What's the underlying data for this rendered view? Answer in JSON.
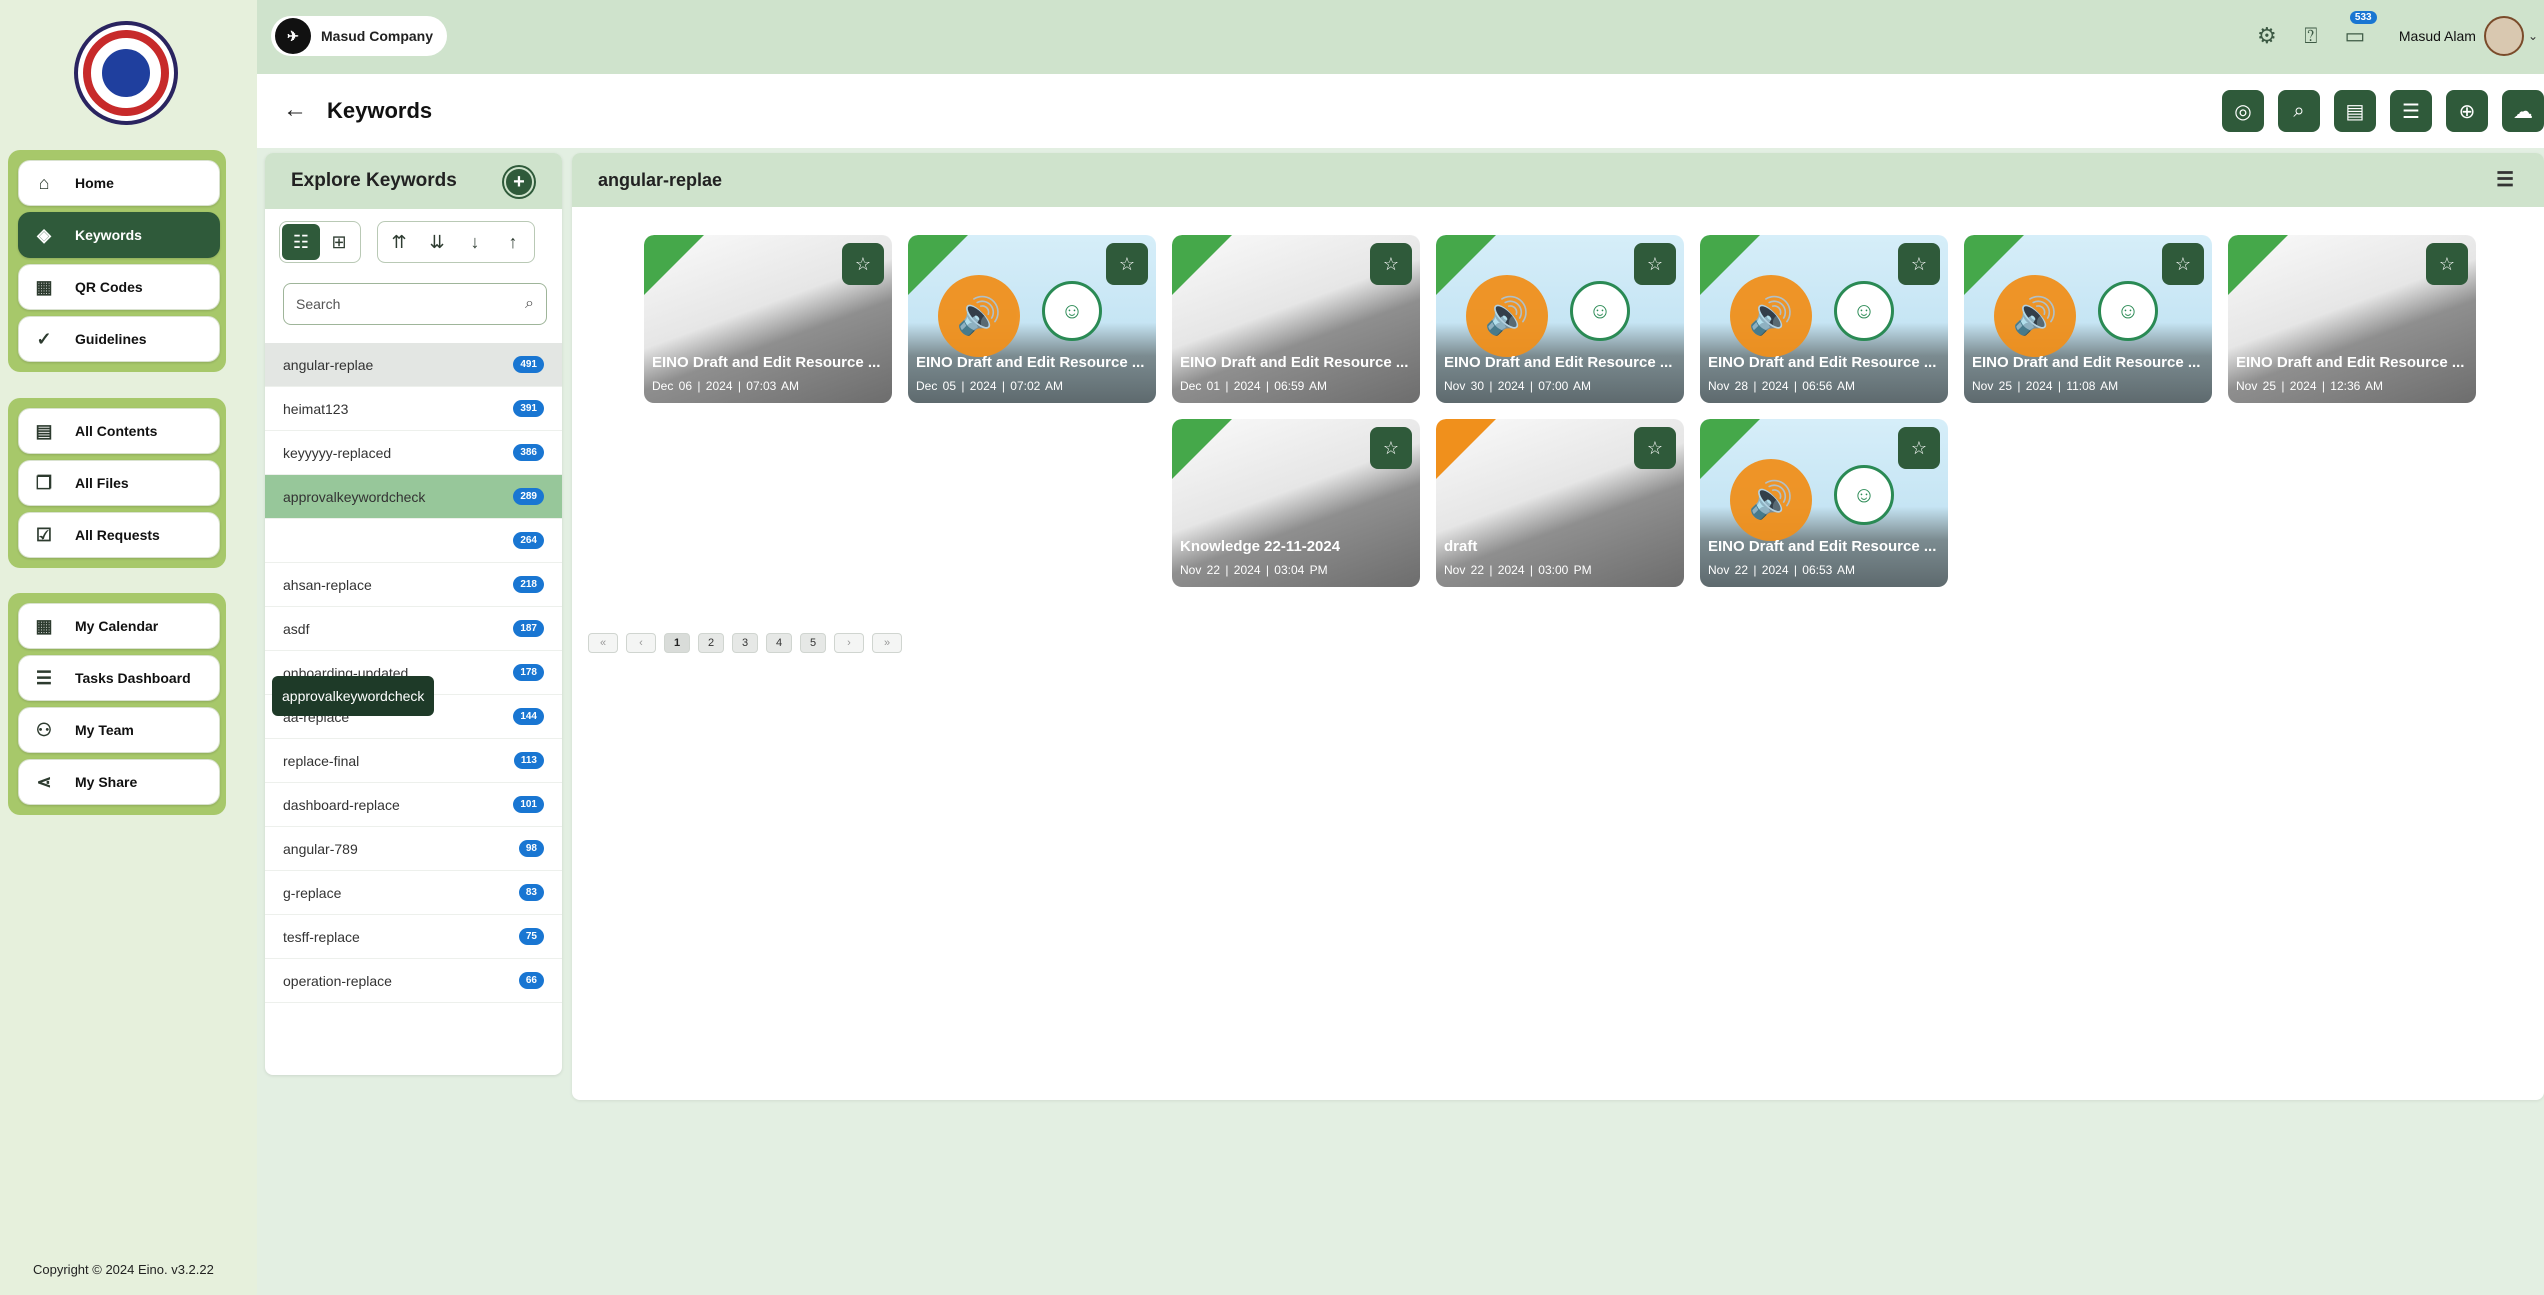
{
  "sidebar": {
    "groups": [
      [
        {
          "label": "Home",
          "icon": "home-icon",
          "glyph": "⌂"
        },
        {
          "label": "Keywords",
          "icon": "tag-icon",
          "glyph": "◈",
          "active": true
        },
        {
          "label": "QR Codes",
          "icon": "qr-code-icon",
          "glyph": "▦"
        },
        {
          "label": "Guidelines",
          "icon": "check-circle-icon",
          "glyph": "✓"
        }
      ],
      [
        {
          "label": "All Contents",
          "icon": "contents-icon",
          "glyph": "▤"
        },
        {
          "label": "All Files",
          "icon": "files-icon",
          "glyph": "❐"
        },
        {
          "label": "All Requests",
          "icon": "requests-icon",
          "glyph": "☑"
        }
      ],
      [
        {
          "label": "My Calendar",
          "icon": "calendar-icon",
          "glyph": "▦"
        },
        {
          "label": "Tasks Dashboard",
          "icon": "tasks-icon",
          "glyph": "☰"
        },
        {
          "label": "My Team",
          "icon": "team-icon",
          "glyph": "⚇"
        },
        {
          "label": "My Share",
          "icon": "share-icon",
          "glyph": "⋖"
        }
      ]
    ],
    "copyright": "Copyright © 2024 Eino. v3.2.22"
  },
  "topbar": {
    "company": "Masud Company",
    "notification_count": "533",
    "user_name": "Masud Alam"
  },
  "page": {
    "title": "Keywords"
  },
  "explore": {
    "title": "Explore Keywords",
    "search_placeholder": "Search",
    "tooltip": "approvalkeywordcheck",
    "keywords": [
      {
        "name": "angular-replae",
        "count": "491",
        "state": "selected"
      },
      {
        "name": "heimat123",
        "count": "391"
      },
      {
        "name": "keyyyyy-replaced",
        "count": "386"
      },
      {
        "name": "approvalkeywordcheck",
        "count": "289",
        "state": "hover"
      },
      {
        "name": "",
        "count": "264"
      },
      {
        "name": "ahsan-replace",
        "count": "218"
      },
      {
        "name": "asdf",
        "count": "187"
      },
      {
        "name": "onboarding-updated",
        "count": "178"
      },
      {
        "name": "aa-replace",
        "count": "144"
      },
      {
        "name": "replace-final",
        "count": "113"
      },
      {
        "name": "dashboard-replace",
        "count": "101"
      },
      {
        "name": "angular-789",
        "count": "98"
      },
      {
        "name": "g-replace",
        "count": "83"
      },
      {
        "name": "tesff-replace",
        "count": "75"
      },
      {
        "name": "operation-replace",
        "count": "66"
      }
    ]
  },
  "content": {
    "title": "angular-replae",
    "cards": [
      {
        "title": "EINO Draft and Edit Resource ...",
        "date": "Dec 06",
        "year": "2024",
        "time": "07:03 AM",
        "image": false,
        "tag": "green"
      },
      {
        "title": "EINO Draft and Edit Resource ...",
        "date": "Dec 05",
        "year": "2024",
        "time": "07:02 AM",
        "image": true,
        "tag": "green"
      },
      {
        "title": "EINO Draft and Edit Resource ...",
        "date": "Dec 01",
        "year": "2024",
        "time": "06:59 AM",
        "image": false,
        "tag": "green"
      },
      {
        "title": "EINO Draft and Edit Resource ...",
        "date": "Nov 30",
        "year": "2024",
        "time": "07:00 AM",
        "image": true,
        "tag": "green"
      },
      {
        "title": "EINO Draft and Edit Resource ...",
        "date": "Nov 28",
        "year": "2024",
        "time": "06:56 AM",
        "image": true,
        "tag": "green"
      },
      {
        "title": "EINO Draft and Edit Resource ...",
        "date": "Nov 25",
        "year": "2024",
        "time": "11:08 AM",
        "image": true,
        "tag": "green"
      },
      {
        "title": "EINO Draft and Edit Resource ...",
        "date": "Nov 25",
        "year": "2024",
        "time": "12:36 AM",
        "image": false,
        "tag": "green"
      },
      {
        "title": "Knowledge 22-11-2024",
        "date": "Nov 22",
        "year": "2024",
        "time": "03:04 PM",
        "image": false,
        "tag": "green"
      },
      {
        "title": "draft",
        "date": "Nov 22",
        "year": "2024",
        "time": "03:00 PM",
        "image": false,
        "tag": "orange"
      },
      {
        "title": "EINO Draft and Edit Resource ...",
        "date": "Nov 22",
        "year": "2024",
        "time": "06:53 AM",
        "image": true,
        "tag": "green"
      }
    ],
    "pager": {
      "first": "«",
      "prev": "‹",
      "next": "›",
      "last": "»",
      "pages": [
        "1",
        "2",
        "3",
        "4",
        "5"
      ],
      "current": "1"
    }
  }
}
